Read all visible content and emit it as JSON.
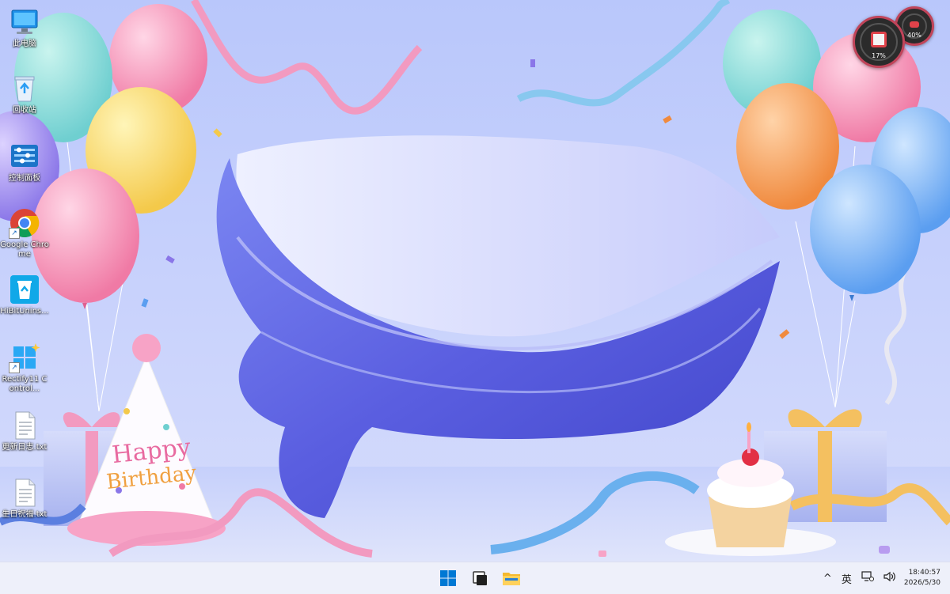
{
  "desktop": {
    "icons": [
      {
        "label": "此电脑",
        "icon": "computer-icon"
      },
      {
        "label": "回收站",
        "icon": "recycle-bin-icon"
      },
      {
        "label": "控制面板",
        "icon": "control-panel-icon"
      },
      {
        "label": "Google Chrome",
        "icon": "chrome-icon"
      },
      {
        "label": "HiBitUnins...",
        "icon": "hibit-uninstaller-icon"
      },
      {
        "label": "Rectify11 Control...",
        "icon": "rectify11-icon"
      },
      {
        "label": "更新日志.txt",
        "icon": "text-file-icon"
      },
      {
        "label": "生日祝福.txt",
        "icon": "text-file-icon"
      }
    ]
  },
  "wallpaper": {
    "hat_text_1": "Happy",
    "hat_text_2": "Birthday"
  },
  "widgets": {
    "gauge_large": {
      "percent": "17%",
      "value": 17
    },
    "gauge_small": {
      "percent": "40%",
      "value": 40
    }
  },
  "taskbar": {
    "apps": [
      "start-button",
      "task-view-button",
      "file-explorer-button"
    ],
    "tray": {
      "overflow": "^",
      "ime": "英"
    },
    "clock": {
      "time": "18:40:57",
      "date": "2026/5/30"
    }
  },
  "colors": {
    "accent": "#5a5ee0",
    "taskbar_bg": "#eef0fa",
    "win_blue": "#0078d4"
  }
}
